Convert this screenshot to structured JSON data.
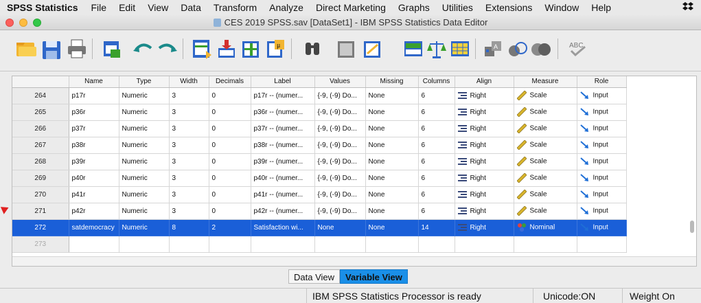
{
  "menubar": {
    "app_name": "SPSS Statistics",
    "items": [
      "File",
      "Edit",
      "View",
      "Data",
      "Transform",
      "Analyze",
      "Direct Marketing",
      "Graphs",
      "Utilities",
      "Extensions",
      "Window",
      "Help"
    ]
  },
  "window": {
    "title": "CES 2019 SPSS.sav [DataSet1] - IBM SPSS Statistics Data Editor"
  },
  "toolbar": {
    "icons": [
      "open-folder-icon",
      "save-icon",
      "print-icon",
      "dialog-recall-icon",
      "undo-icon",
      "redo-icon",
      "goto-case-icon",
      "goto-variable-icon",
      "variables-icon",
      "run-descriptives-icon",
      "find-icon",
      "insert-cases-icon",
      "insert-variable-icon",
      "split-file-icon",
      "weight-cases-icon",
      "select-cases-icon",
      "value-labels-icon",
      "use-sets-icon",
      "show-all-variables-icon",
      "spell-check-icon"
    ]
  },
  "grid": {
    "columns": [
      "Name",
      "Type",
      "Width",
      "Decimals",
      "Label",
      "Values",
      "Missing",
      "Columns",
      "Align",
      "Measure",
      "Role"
    ],
    "rows": [
      {
        "num": "264",
        "name": "p17r",
        "type": "Numeric",
        "width": "3",
        "decimals": "0",
        "label": "p17r -- (numer...",
        "values": "{-9, (-9) Do...",
        "missing": "None",
        "columns": "6",
        "align": "Right",
        "measure": "Scale",
        "role": "Input"
      },
      {
        "num": "265",
        "name": "p36r",
        "type": "Numeric",
        "width": "3",
        "decimals": "0",
        "label": "p36r -- (numer...",
        "values": "{-9, (-9) Do...",
        "missing": "None",
        "columns": "6",
        "align": "Right",
        "measure": "Scale",
        "role": "Input"
      },
      {
        "num": "266",
        "name": "p37r",
        "type": "Numeric",
        "width": "3",
        "decimals": "0",
        "label": "p37r -- (numer...",
        "values": "{-9, (-9) Do...",
        "missing": "None",
        "columns": "6",
        "align": "Right",
        "measure": "Scale",
        "role": "Input"
      },
      {
        "num": "267",
        "name": "p38r",
        "type": "Numeric",
        "width": "3",
        "decimals": "0",
        "label": "p38r -- (numer...",
        "values": "{-9, (-9) Do...",
        "missing": "None",
        "columns": "6",
        "align": "Right",
        "measure": "Scale",
        "role": "Input"
      },
      {
        "num": "268",
        "name": "p39r",
        "type": "Numeric",
        "width": "3",
        "decimals": "0",
        "label": "p39r -- (numer...",
        "values": "{-9, (-9) Do...",
        "missing": "None",
        "columns": "6",
        "align": "Right",
        "measure": "Scale",
        "role": "Input"
      },
      {
        "num": "269",
        "name": "p40r",
        "type": "Numeric",
        "width": "3",
        "decimals": "0",
        "label": "p40r -- (numer...",
        "values": "{-9, (-9) Do...",
        "missing": "None",
        "columns": "6",
        "align": "Right",
        "measure": "Scale",
        "role": "Input"
      },
      {
        "num": "270",
        "name": "p41r",
        "type": "Numeric",
        "width": "3",
        "decimals": "0",
        "label": "p41r -- (numer...",
        "values": "{-9, (-9) Do...",
        "missing": "None",
        "columns": "6",
        "align": "Right",
        "measure": "Scale",
        "role": "Input"
      },
      {
        "num": "271",
        "name": "p42r",
        "type": "Numeric",
        "width": "3",
        "decimals": "0",
        "label": "p42r -- (numer...",
        "values": "{-9, (-9) Do...",
        "missing": "None",
        "columns": "6",
        "align": "Right",
        "measure": "Scale",
        "role": "Input"
      },
      {
        "num": "272",
        "name": "satdemocracy",
        "type": "Numeric",
        "width": "8",
        "decimals": "2",
        "label": "Satisfaction wi...",
        "values": "None",
        "missing": "None",
        "columns": "14",
        "align": "Right",
        "measure": "Nominal",
        "role": "Input",
        "selected": true
      },
      {
        "num": "273",
        "name": "",
        "type": "",
        "width": "",
        "decimals": "",
        "label": "",
        "values": "",
        "missing": "",
        "columns": "",
        "align": "",
        "measure": "",
        "role": "",
        "empty": true
      }
    ]
  },
  "tabs": {
    "data_view": "Data View",
    "variable_view": "Variable View"
  },
  "status": {
    "processor": "IBM SPSS Statistics Processor is ready",
    "unicode": "Unicode:ON",
    "weight": "Weight On"
  },
  "colors": {
    "selection": "#1a5fd8",
    "active_tab": "#1a8fe8",
    "scale_ruler": "#d8b42c",
    "input_arrow": "#1f6fd6"
  }
}
